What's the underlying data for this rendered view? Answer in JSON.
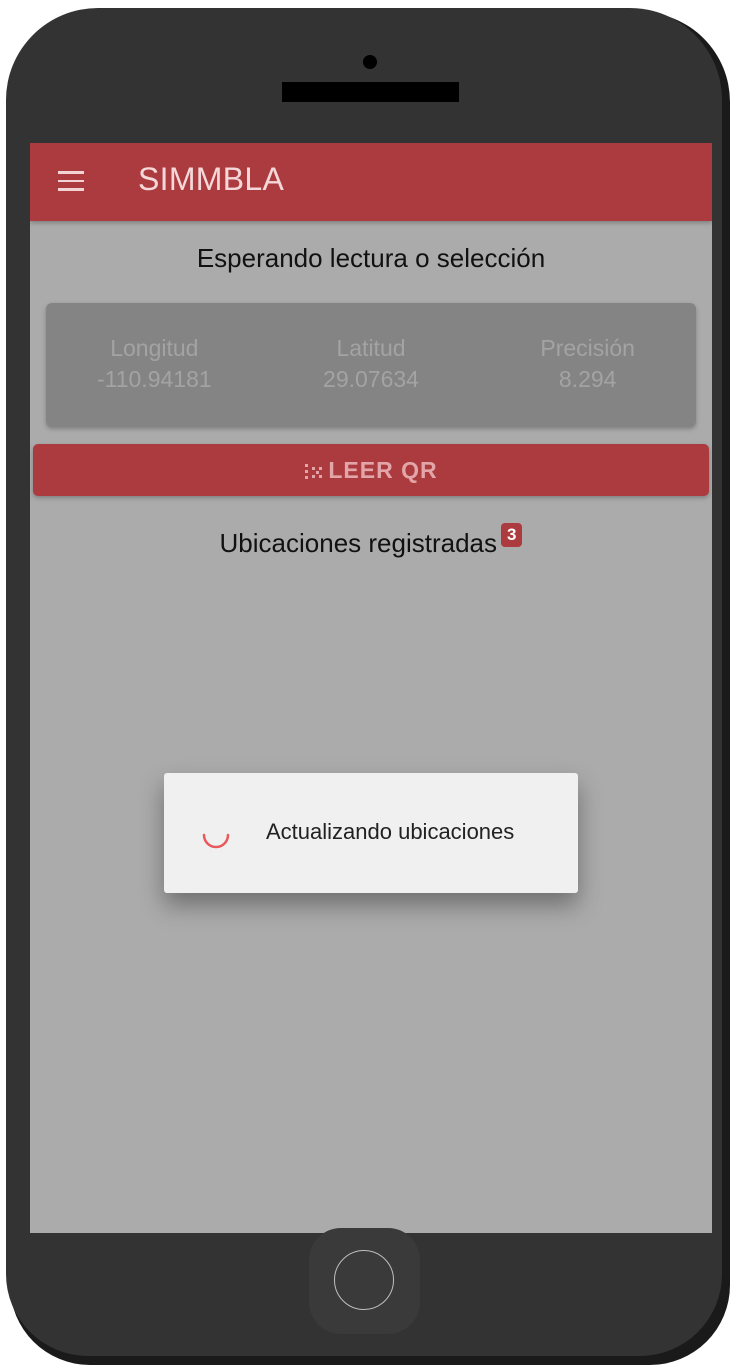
{
  "appbar": {
    "title": "SIMMBLA",
    "menu_icon": "hamburger-menu-icon"
  },
  "status": {
    "text": "Esperando lectura o selección"
  },
  "coordinates": [
    {
      "label": "Longitud",
      "value": "-110.94181"
    },
    {
      "label": "Latitud",
      "value": "29.07634"
    },
    {
      "label": "Precisión",
      "value": "8.294"
    }
  ],
  "qr_button": {
    "label": "LEER QR",
    "icon": "qr-code-icon"
  },
  "locations": {
    "title": "Ubicaciones registradas",
    "count": "3"
  },
  "dialog": {
    "message": "Actualizando ubicaciones",
    "icon": "loading-spinner-icon"
  },
  "colors": {
    "accent": "#ac3b3f",
    "background": "#ababab",
    "card": "#848484",
    "spinner": "#e8595d"
  }
}
